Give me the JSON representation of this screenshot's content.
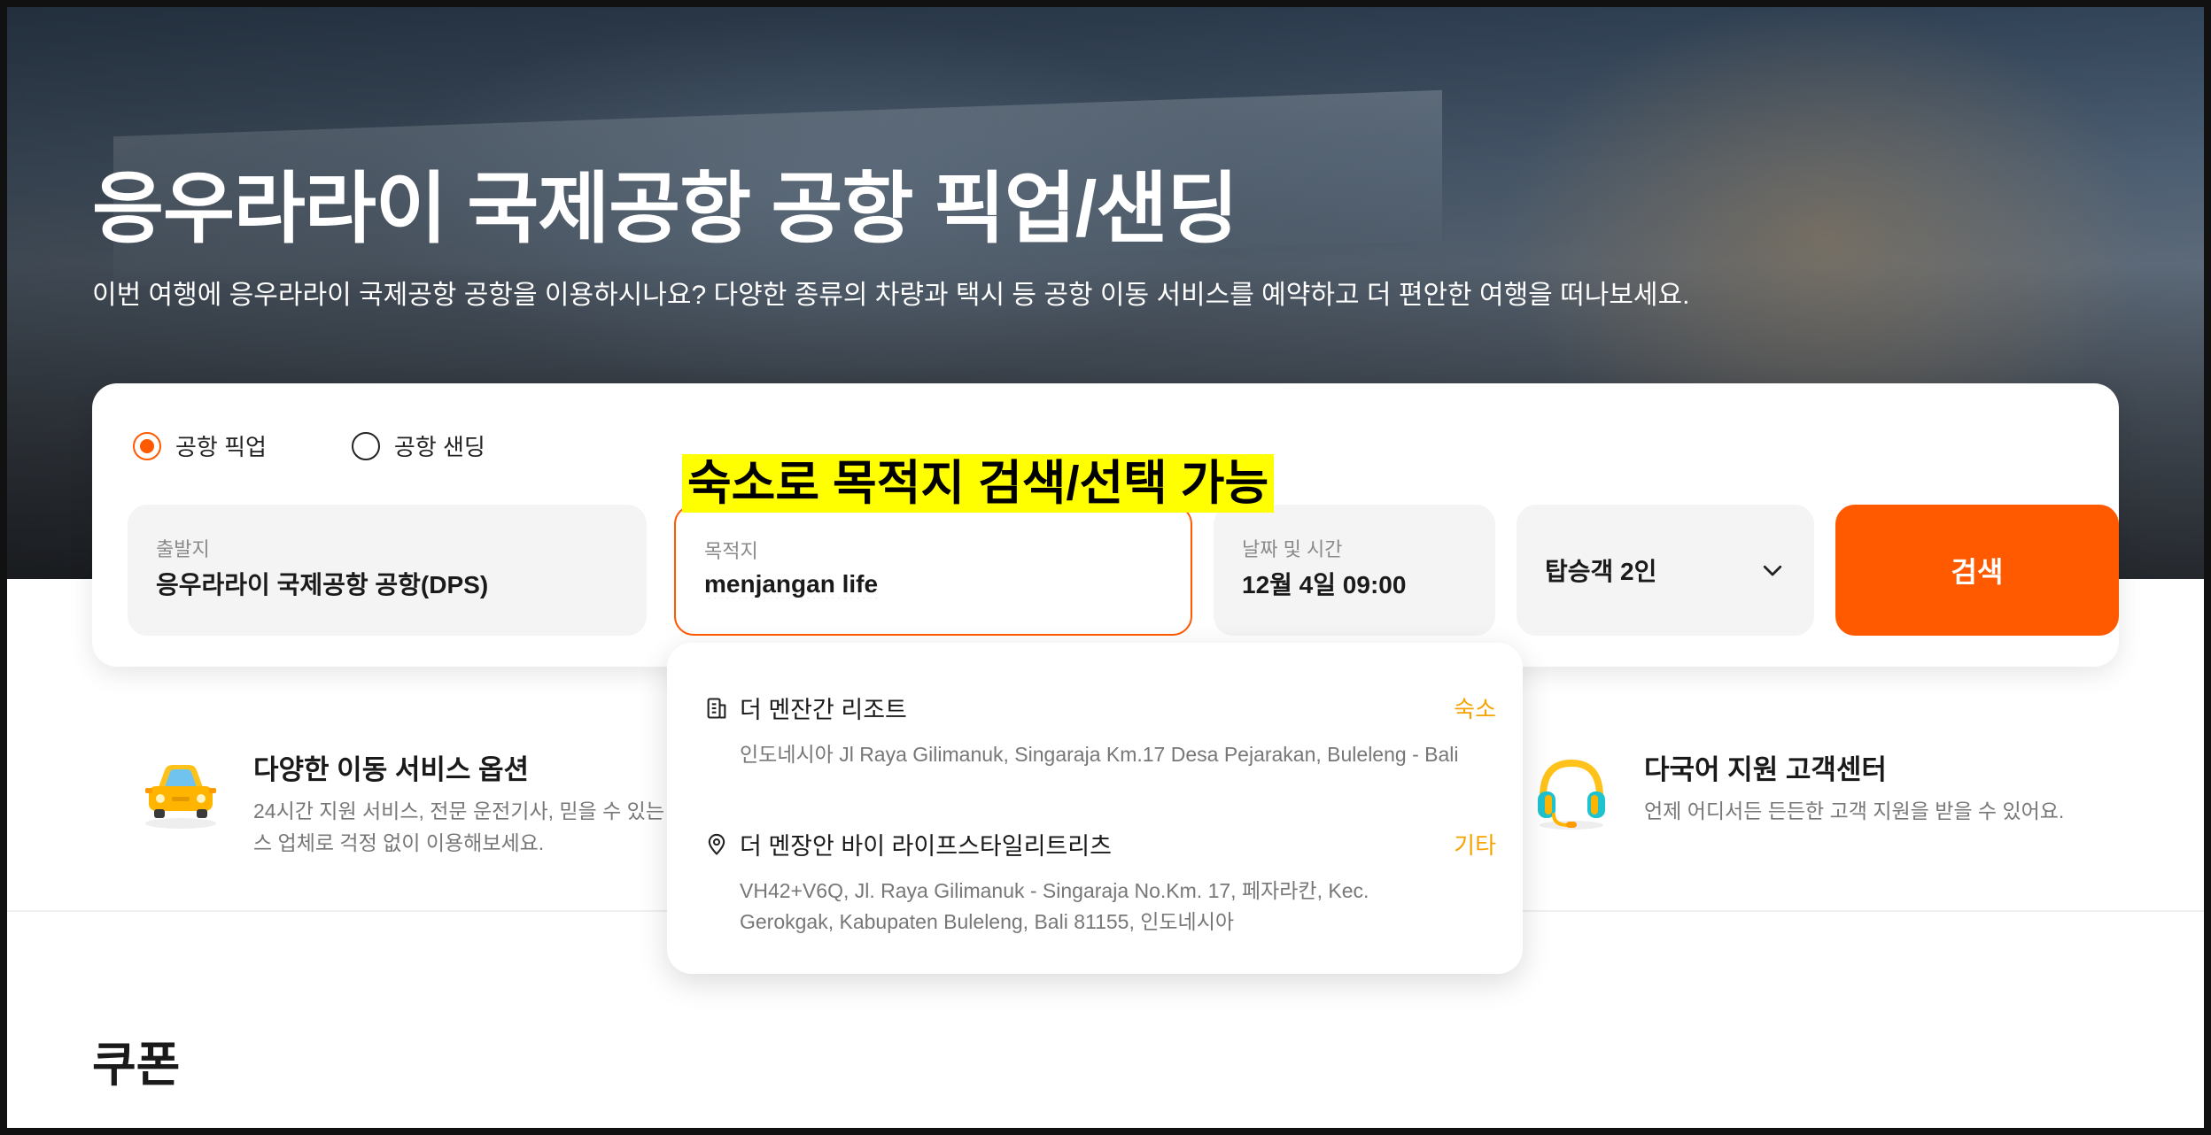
{
  "hero": {
    "title": "응우라라이 국제공항 공항 픽업/샌딩",
    "subtitle": "이번 여행에 응우라라이 국제공항 공항을 이용하시나요? 다양한 종류의 차량과 택시 등 공항 이동 서비스를 예약하고 더 편안한 여행을 떠나보세요."
  },
  "trip_type": {
    "options": [
      {
        "label": "공항 픽업",
        "selected": true
      },
      {
        "label": "공항 샌딩",
        "selected": false
      }
    ]
  },
  "search": {
    "origin": {
      "label": "출발지",
      "value": "응우라라이 국제공항 공항(DPS)"
    },
    "destination": {
      "label": "목적지",
      "value": "menjangan life"
    },
    "datetime": {
      "label": "날짜 및 시간",
      "value": "12월 4일 09:00"
    },
    "passengers": {
      "value": "탑승객 2인",
      "icon": "chevron-down-icon"
    },
    "button_label": "검색"
  },
  "annotation": {
    "text": "숙소로 목적지 검색/선택 가능"
  },
  "suggestions": [
    {
      "icon": "hotel-building-icon",
      "name": "더 멘잔간 리조트",
      "type": "숙소",
      "address": "인도네시아 Jl Raya Gilimanuk, Singaraja Km.17 Desa Pejarakan, Buleleng - Bali"
    },
    {
      "icon": "location-pin-icon",
      "name": "더 멘장안 바이 라이프스타일리트리츠",
      "type": "기타",
      "address": "VH42+V6Q, Jl. Raya Gilimanuk - Singaraja No.Km. 17, 페자라칸, Kec. Gerokgak, Kabupaten Buleleng, Bali 81155, 인도네시아"
    }
  ],
  "features": [
    {
      "icon": "car-icon",
      "title": "다양한 이동 서비스 옵션",
      "desc": "24시간 지원 서비스, 전문 운전기사, 믿을 수 있는 서비스 업체로 걱정 없이 이용해보세요."
    },
    {
      "icon": "headset-icon",
      "title": "다국어 지원 고객센터",
      "desc": "언제 어디서든 든든한 고객 지원을 받을 수 있어요."
    }
  ],
  "coupon": {
    "title": "쿠폰"
  },
  "colors": {
    "accent": "#ff5a00",
    "highlight": "#ffff00",
    "type_label": "#f5a300"
  }
}
